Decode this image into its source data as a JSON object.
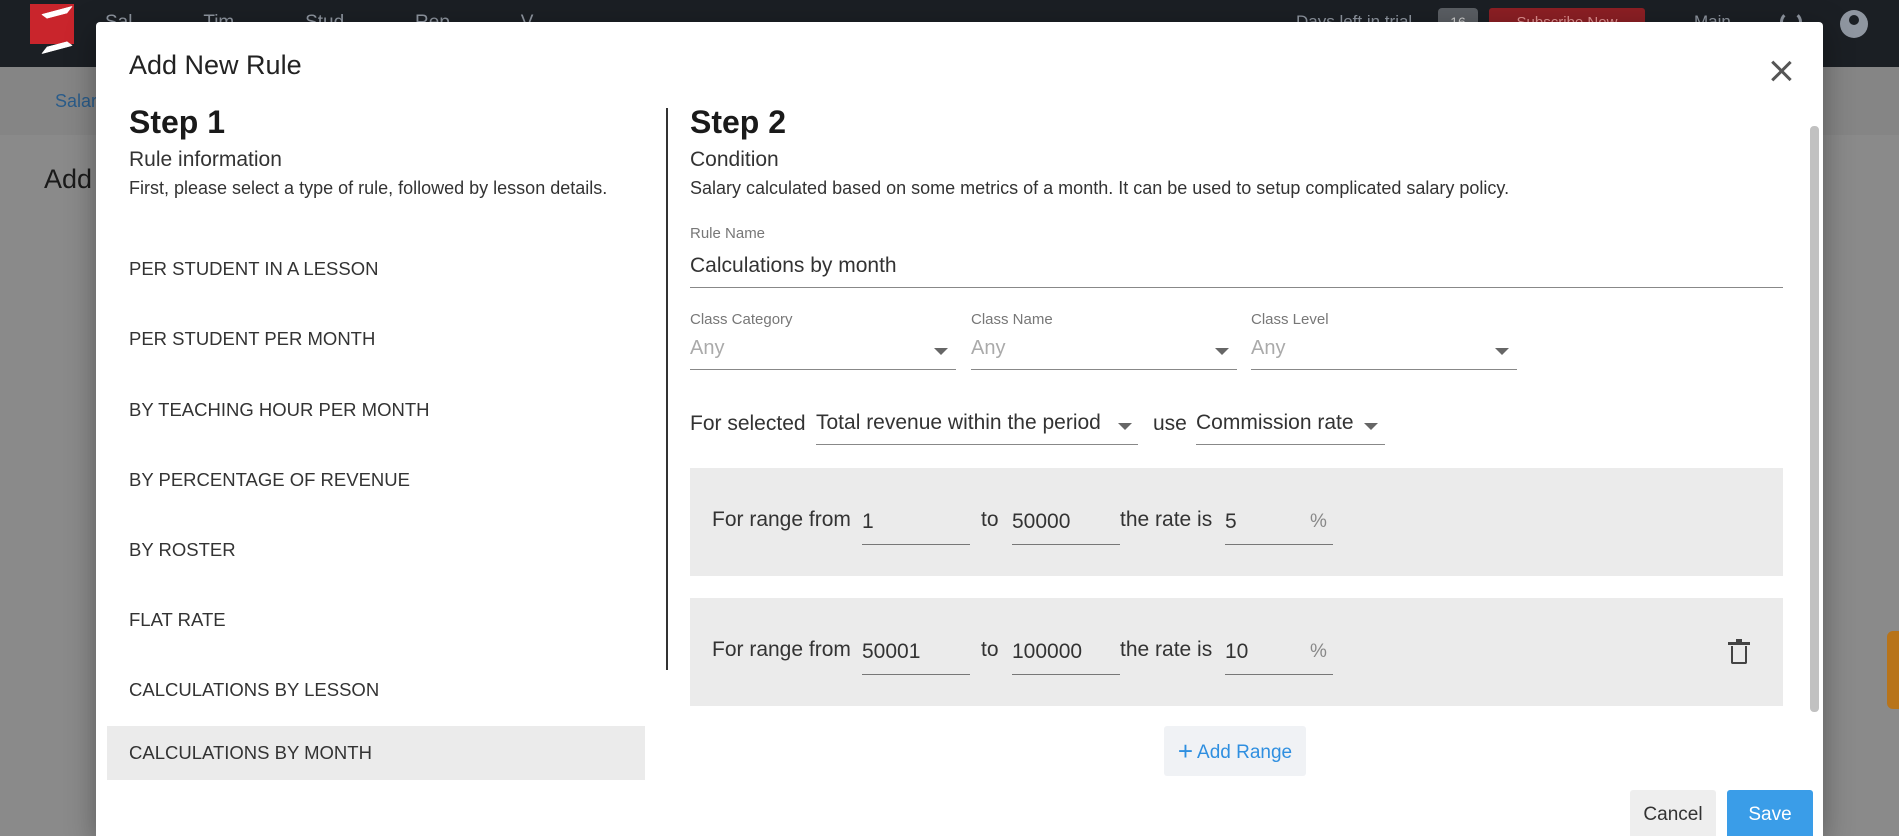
{
  "background": {
    "nav": [
      "Sal...",
      "Tim...",
      "Stud...",
      "Rep...",
      "V..."
    ],
    "trial_text": "Days left in trial",
    "trial_badge": "16",
    "subscribe": "Subscribe Now",
    "main": "Main",
    "sub_link": "Salar",
    "page_heading": "Add"
  },
  "modal": {
    "title": "Add New Rule",
    "step1": {
      "title": "Step 1",
      "subtitle": "Rule information",
      "description": "First, please select a type of rule, followed by lesson details.",
      "rule_types": [
        "PER STUDENT IN A LESSON",
        "PER STUDENT PER MONTH",
        "BY TEACHING HOUR PER MONTH",
        "BY PERCENTAGE OF REVENUE",
        "BY ROSTER",
        "FLAT RATE",
        "CALCULATIONS BY LESSON",
        "CALCULATIONS BY MONTH"
      ],
      "selected_index": 7
    },
    "step2": {
      "title": "Step 2",
      "subtitle": "Condition",
      "description": "Salary calculated based on some metrics of a month. It can be used to setup complicated salary policy.",
      "rule_name_label": "Rule Name",
      "rule_name_value": "Calculations by month",
      "class_category_label": "Class Category",
      "class_category_value": "Any",
      "class_name_label": "Class Name",
      "class_name_value": "Any",
      "class_level_label": "Class Level",
      "class_level_value": "Any",
      "for_selected": "For selected",
      "metric_value": "Total revenue within the period",
      "use": "use",
      "rate_type_value": "Commission rate",
      "range_from_label": "For range from",
      "to_label": "to",
      "rate_is_label": "the rate is",
      "percent": "%",
      "ranges": [
        {
          "from": "1",
          "to": "50000",
          "rate": "5"
        },
        {
          "from": "50001",
          "to": "100000",
          "rate": "10"
        }
      ],
      "add_range": "Add Range"
    },
    "cancel": "Cancel",
    "save": "Save"
  }
}
